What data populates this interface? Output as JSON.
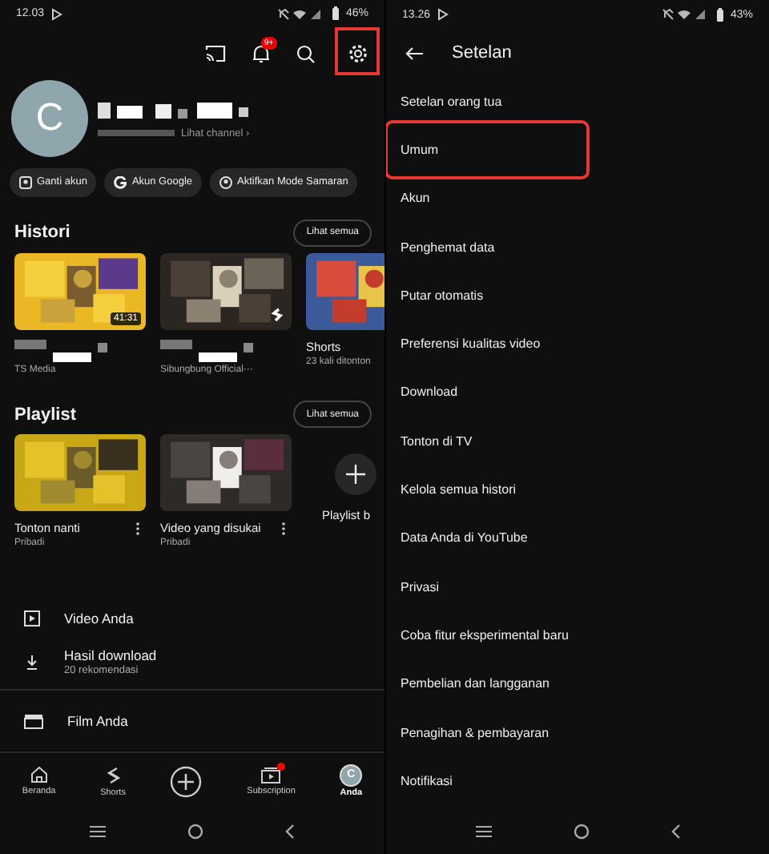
{
  "home_screen": {
    "status_bar": {
      "time": "12.03",
      "battery": "46%"
    },
    "top_bar": {
      "notification_badge": "9+",
      "settings_highlighted": true
    },
    "profile": {
      "avatar_letter": "C",
      "channel_link": "Lihat channel ›"
    },
    "chips": [
      {
        "kind": "switch",
        "label": "Ganti akun"
      },
      {
        "kind": "google",
        "label": "Akun Google"
      },
      {
        "kind": "incognito",
        "label": "Aktifkan Mode Samaran"
      }
    ],
    "history": {
      "title": "Histori",
      "see_all": "Lihat semua",
      "items": [
        {
          "kind": "video",
          "duration": "41:31",
          "subtitle": "TS Media"
        },
        {
          "kind": "short",
          "subtitle": "Sibungbung Official···"
        },
        {
          "kind": "short",
          "title": "Shorts",
          "subtitle": "23 kali ditonton"
        }
      ]
    },
    "playlists": {
      "title": "Playlist",
      "see_all": "Lihat semua",
      "items": [
        {
          "title": "Tonton nanti",
          "subtitle": "Pribadi"
        },
        {
          "title": "Video yang disukai",
          "subtitle": "Pribadi"
        }
      ],
      "new_label": "Playlist b"
    },
    "menu": [
      {
        "kind": "video",
        "label": "Video Anda"
      },
      {
        "kind": "download",
        "label": "Hasil download",
        "sub": "20 rekomendasi"
      },
      {
        "kind": "film",
        "label": "Film Anda"
      }
    ],
    "bottom_nav": [
      {
        "kind": "home",
        "label": "Beranda",
        "selected": false,
        "dot": false
      },
      {
        "kind": "shorts",
        "label": "Shorts",
        "selected": false,
        "dot": false
      },
      {
        "kind": "create",
        "selected": false,
        "dot": false
      },
      {
        "kind": "subs",
        "label": "Subscription",
        "selected": false,
        "dot": true
      },
      {
        "kind": "avatar",
        "avatar_letter": "C",
        "label": "Anda",
        "selected": true,
        "dot": false
      }
    ]
  },
  "settings_screen": {
    "status_bar": {
      "time": "13.26",
      "battery": "43%"
    },
    "title": "Setelan",
    "items": [
      {
        "label": "Setelan orang tua",
        "highlighted": false
      },
      {
        "label": "Umum",
        "highlighted": true
      },
      {
        "label": "Akun",
        "highlighted": false
      },
      {
        "label": "Penghemat data",
        "highlighted": false
      },
      {
        "label": "Putar otomatis",
        "highlighted": false
      },
      {
        "label": "Preferensi kualitas video",
        "highlighted": false
      },
      {
        "label": "Download",
        "highlighted": false
      },
      {
        "label": "Tonton di TV",
        "highlighted": false
      },
      {
        "label": "Kelola semua histori",
        "highlighted": false
      },
      {
        "label": "Data Anda di YouTube",
        "highlighted": false
      },
      {
        "label": "Privasi",
        "highlighted": false
      },
      {
        "label": "Coba fitur eksperimental baru",
        "highlighted": false
      },
      {
        "label": "Pembelian dan langganan",
        "highlighted": false
      },
      {
        "label": "Penagihan & pembayaran",
        "highlighted": false
      },
      {
        "label": "Notifikasi",
        "highlighted": false
      }
    ]
  }
}
